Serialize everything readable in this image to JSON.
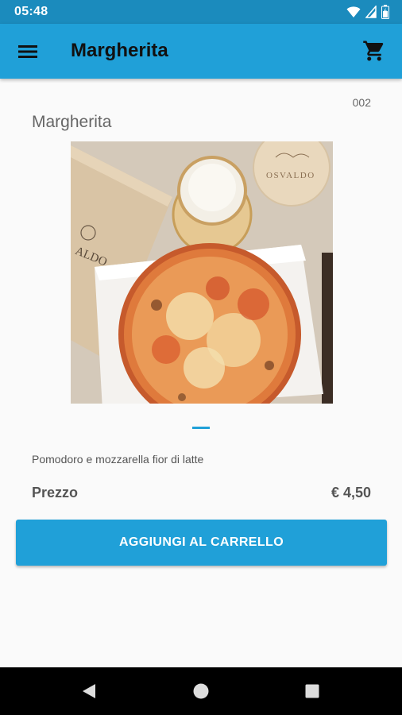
{
  "status_bar": {
    "time": "05:48",
    "icons": [
      "wifi-icon",
      "signal-icon",
      "battery-icon"
    ]
  },
  "app_bar": {
    "title": "Margherita",
    "menu_icon": "menu-icon",
    "cart_icon": "cart-icon"
  },
  "product": {
    "code": "002",
    "name": "Margherita",
    "description": "Pomodoro e mozzarella fior di latte",
    "price_label": "Prezzo",
    "price_value": "€ 4,50"
  },
  "gallery": {
    "image_subject": "pizza margherita",
    "active_page": 1,
    "page_count": 1
  },
  "actions": {
    "add_to_cart_label": "AGGIUNGI AL CARRELLO"
  },
  "navigation_bar": {
    "buttons": [
      "back-icon",
      "home-icon",
      "recents-icon"
    ]
  },
  "colors": {
    "primary": "#20a0d8",
    "primary_dark": "#1b8bbd",
    "background": "#fafafa"
  }
}
